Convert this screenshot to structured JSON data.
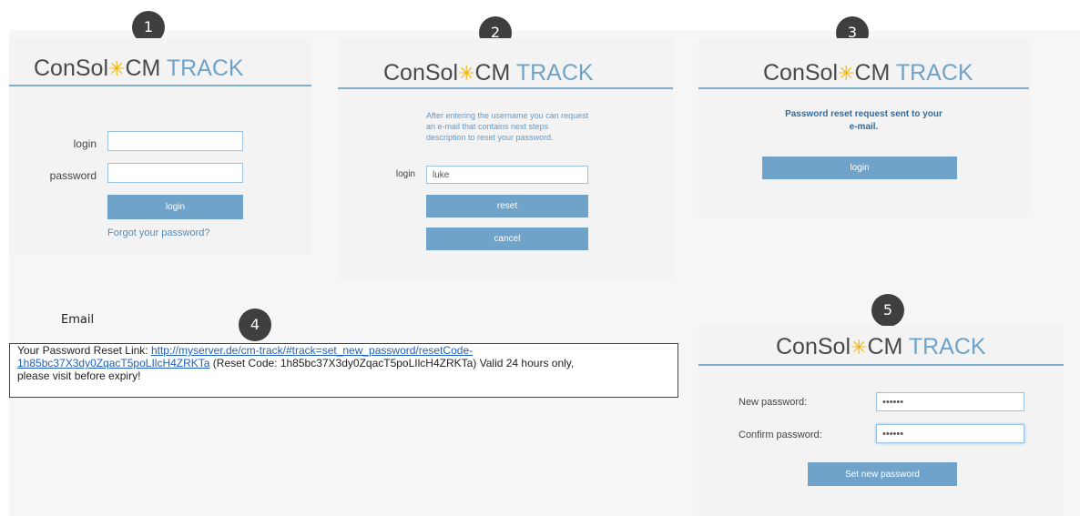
{
  "badges": [
    "1",
    "2",
    "3",
    "4",
    "5"
  ],
  "logo": {
    "part1": "ConSol",
    "star": "✳",
    "part2": "CM",
    "part3": "TRACK"
  },
  "colors": {
    "accent": "#6fa3c9",
    "rule": "#7eadd0",
    "link": "#1f5fbf",
    "badge": "#3f3f3f",
    "logo_star": "#f2b705"
  },
  "panel1": {
    "login_label": "login",
    "password_label": "password",
    "login_value": "",
    "password_value": "",
    "login_button": "login",
    "forgot_link": "Forgot your password?"
  },
  "panel2": {
    "message": "After entering the username you can request an e-mail that contains next steps description to reset your password.",
    "login_label": "login",
    "login_value": "luke",
    "reset_button": "reset",
    "cancel_button": "cancel"
  },
  "panel3": {
    "message_line1": "Password reset request sent to your",
    "message_line2": "e-mail.",
    "login_button": "login"
  },
  "email": {
    "label": "Email",
    "intro": "Your Password Reset Link: ",
    "link_line1": "http://myserver.de/cm-track/#track=set_new_password/resetCode-",
    "link_line2": "1h85bc37X3dy0ZqacT5poLIlcH4ZRKTa",
    "reset_code_text": " (Reset Code: 1h85bc37X3dy0ZqacT5poLIlcH4ZRKTa)  Valid 24 hours only,",
    "tail": "please visit before expiry!"
  },
  "panel5": {
    "new_password_label": "New password:",
    "confirm_password_label": "Confirm password:",
    "new_password_value": "••••••",
    "confirm_password_value": "••••••",
    "set_button": "Set new password"
  }
}
